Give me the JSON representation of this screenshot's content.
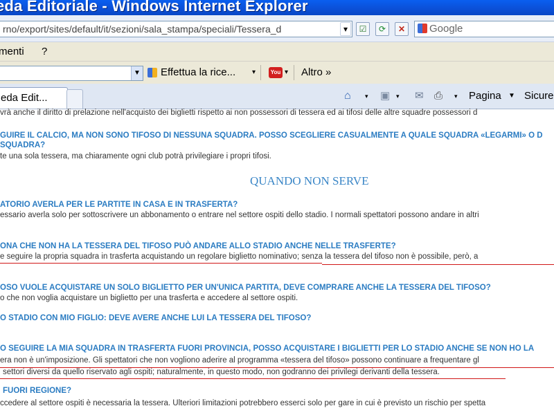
{
  "window": {
    "title": "eda Editoriale - Windows Internet Explorer"
  },
  "address": {
    "url": "rno/export/sites/default/it/sezioni/sala_stampa/speciali/Tessera_d",
    "search_placeholder": "Google"
  },
  "menu": {
    "items": [
      "menti",
      "?"
    ]
  },
  "google_toolbar": {
    "search_label": "Effettua la rice...",
    "more_label": "Altro »"
  },
  "tabs": {
    "active_label": "eda Edit..."
  },
  "tools": {
    "page_label": "Pagina",
    "safety_label": "Sicure"
  },
  "content": {
    "lines": [
      {
        "text": "vrà anche il diritto di prelazione nell'acquisto dei biglietti rispetto ai non possessori di tessera ed ai tifosi delle altre squadre possessori d",
        "kind": "body"
      },
      {
        "text": "GUIRE IL CALCIO, MA NON SONO TIFOSO DI NESSUNA SQUADRA. POSSO SCEGLIERE CASUALMENTE A QUALE SQUADRA «LEGARMI» O D",
        "kind": "q"
      },
      {
        "text": "SQUADRA?",
        "kind": "q"
      },
      {
        "text": "te una sola tessera, ma chiaramente ogni club potrà privilegiare i propri tifosi.",
        "kind": "body"
      },
      {
        "text": "ATORIO AVERLA PER LE PARTITE IN CASA E IN TRASFERTA?",
        "kind": "q"
      },
      {
        "text": "essario averla solo per sottoscrivere un abbonamento o entrare nel settore ospiti dello stadio. I normali spettatori possono andare in altri",
        "kind": "body"
      },
      {
        "text": "ONA CHE NON HA LA TESSERA DEL TIFOSO PUÒ ANDARE ALLO STADIO ANCHE NELLE TRASFERTE?",
        "kind": "q"
      },
      {
        "text": "e seguire la propria squadra in trasferta acquistando un regolare biglietto nominativo; senza la tessera del tifoso non è possibile, però, a",
        "kind": "body"
      },
      {
        "text": "OSO VUOLE ACQUISTARE UN SOLO BIGLIETTO PER UN'UNICA PARTITA, DEVE COMPRARE ANCHE LA TESSERA DEL TIFOSO?",
        "kind": "q"
      },
      {
        "text": "o che non voglia acquistare un biglietto per una trasferta e accedere al settore ospiti.",
        "kind": "body"
      },
      {
        "text": "O STADIO CON MIO FIGLIO: DEVE AVERE ANCHE LUI LA TESSERA DEL TIFOSO?",
        "kind": "q"
      },
      {
        "text": "O SEGUIRE LA MIA SQUADRA IN TRASFERTA FUORI PROVINCIA, POSSO ACQUISTARE I BIGLIETTI PER LO STADIO ANCHE SE NON HO LA",
        "kind": "q"
      },
      {
        "text": "era non è un'imposizione. Gli spettatori che non vogliono aderire al programma «tessera del tifoso» possono continuare a frequentare gl",
        "kind": "body"
      },
      {
        "text": "settori diversi da quello riservato agli ospiti; naturalmente, in questo modo, non godranno dei privilegi derivanti della tessera.",
        "kind": "body"
      },
      {
        "text": "FUORI REGIONE?",
        "kind": "q"
      },
      {
        "text": "ccedere al settore ospiti è necessaria la tessera. Ulteriori limitazioni potrebbero esserci solo per gare in cui è previsto un rischio per spetta",
        "kind": "body"
      }
    ],
    "section_heading": "QUANDO NON SERVE"
  }
}
